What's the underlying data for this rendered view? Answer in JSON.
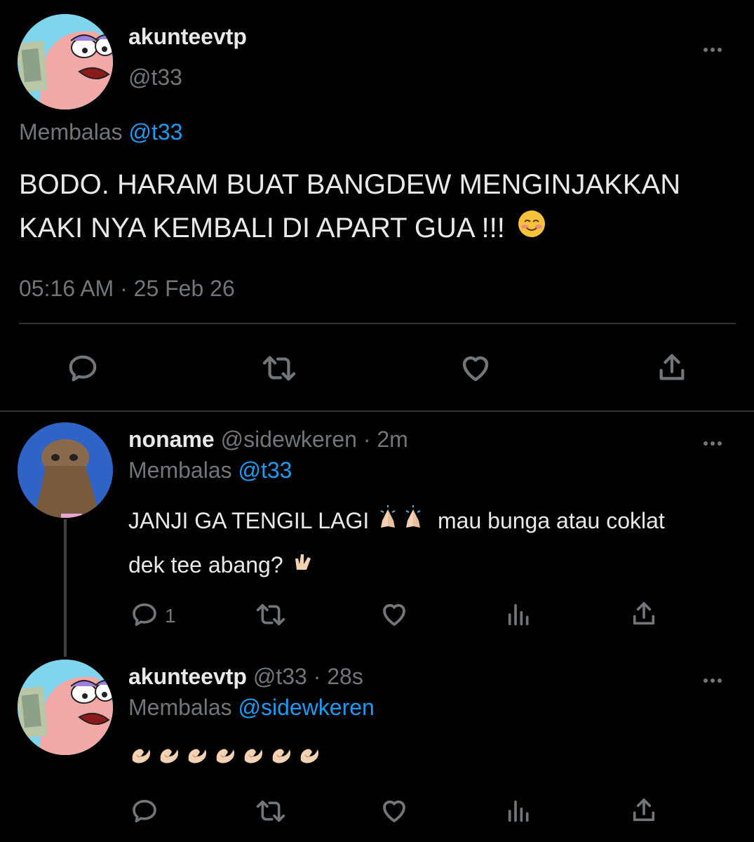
{
  "main_tweet": {
    "display_name": "akunteevtp",
    "handle": "@t33",
    "reply_prefix": "Membalas",
    "reply_to": "@t33",
    "text_line1": "BODO. HARAM BUAT BANGDEW MENGINJAKKAN",
    "text_line2": "KAKI NYA KEMBALI DI APART GUA !!!",
    "timestamp": "05:16 AM · 25 Feb 26",
    "emoji_names": [
      "smiling-blush-emoji"
    ]
  },
  "reply1": {
    "display_name": "noname",
    "handle": "@sidewkeren",
    "separator": "·",
    "age": "2m",
    "reply_prefix": "Membalas",
    "reply_to": "@t33",
    "text_part1": "JANJI GA TENGIL LAGI",
    "text_part2": "mau bunga atau coklat",
    "text_line2": "dek tee abang?",
    "reply_count": "1"
  },
  "reply2": {
    "display_name": "akunteevtp",
    "handle": "@t33",
    "separator": "·",
    "age": "28s",
    "reply_prefix": "Membalas",
    "reply_to": "@sidewkeren",
    "emoji_count": 7
  },
  "colors": {
    "background": "#000000",
    "text": "#e7e9ea",
    "muted": "#71767b",
    "link": "#1d9bf0",
    "divider": "#2f3336"
  }
}
